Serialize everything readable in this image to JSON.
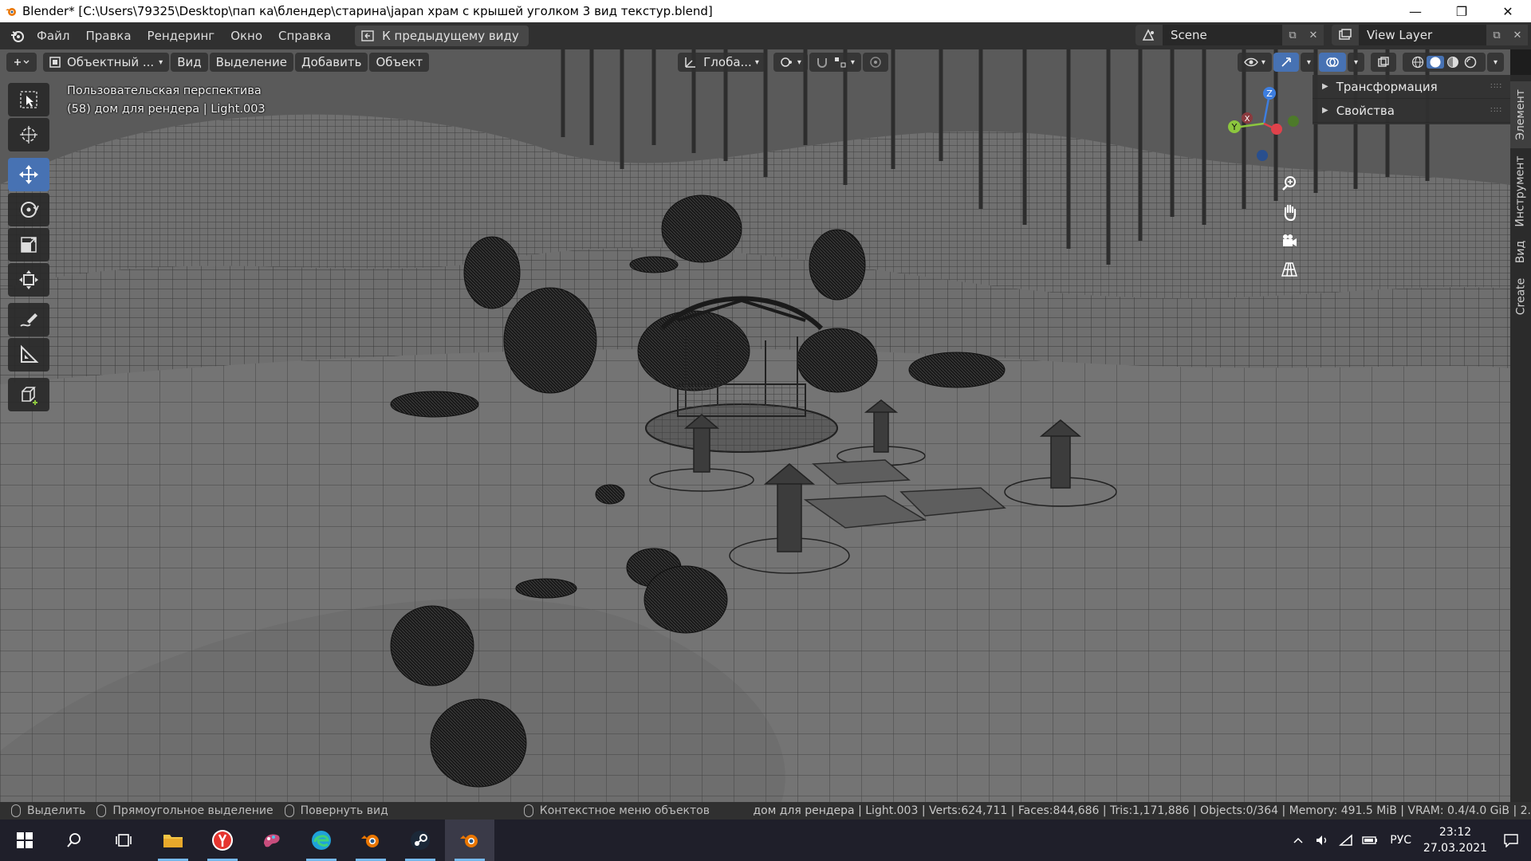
{
  "window": {
    "title": "Blender* [C:\\Users\\79325\\Desktop\\пап ка\\блендер\\старина\\japan храм с крышей уголком 3 вид текстур.blend]",
    "minimize": "—",
    "maximize": "❐",
    "close": "✕"
  },
  "menu": {
    "items": [
      "Файл",
      "Правка",
      "Рендеринг",
      "Окно",
      "Справка"
    ],
    "prev_view": "К предыдущему виду",
    "scene": "Scene",
    "view_layer": "View Layer"
  },
  "viewport_header": {
    "mode": "Объектный ...",
    "menus": [
      "Вид",
      "Выделение",
      "Добавить",
      "Объект"
    ],
    "orientation": "Глоба..."
  },
  "viewport": {
    "perspective": "Пользовательская перспектива",
    "active": "(58) дом для рендера | Light.003"
  },
  "gizmo": {
    "x": "X",
    "y": "Y",
    "z": "Z",
    "x_color": "#e0424b",
    "y_color": "#8cc63e",
    "z_color": "#3d7ee0"
  },
  "npanel": {
    "rows": [
      "Трансформация",
      "Свойства"
    ],
    "tabs": [
      "Элемент",
      "Инструмент",
      "Вид",
      "Create"
    ]
  },
  "statusbar": {
    "select": "Выделить",
    "box_select": "Прямоугольное выделение",
    "rotate": "Повернуть вид",
    "context": "Контекстное меню объектов",
    "stats": "дом для рендера | Light.003 | Verts:624,711 | Faces:844,686 | Tris:1,171,886 | Objects:0/364 | Memory: 491.5 MiB | VRAM: 0.4/4.0 GiB | 2."
  },
  "taskbar": {
    "lang": "РУС",
    "time": "23:12",
    "date": "27.03.2021"
  },
  "colors": {
    "accent": "#4772b3",
    "viewport_bg": "#6b6b6b",
    "header_bg": "#303030"
  }
}
